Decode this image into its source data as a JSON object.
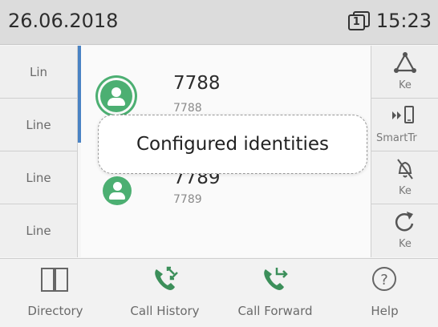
{
  "status": {
    "date": "26.06.2018",
    "line_number": "1",
    "time": "15:23"
  },
  "line_keys": [
    "Lin",
    "Line",
    "Line",
    "Line"
  ],
  "identities": [
    {
      "name": "7788",
      "number": "7788",
      "avatar_icon": "user-icon",
      "selected": true
    },
    {
      "name": "7789",
      "number": "7789",
      "avatar_icon": "user-icon",
      "selected": false
    }
  ],
  "tooltip": "Configured identities",
  "function_keys": [
    {
      "label": "Ke",
      "icon": "network-icon"
    },
    {
      "label": "SmartTr",
      "icon": "smart-transfer-icon"
    },
    {
      "label": "Ke",
      "icon": "bell-off-icon"
    },
    {
      "label": "Ke",
      "icon": "refresh-icon"
    }
  ],
  "softkeys": [
    {
      "label": "Directory",
      "icon": "book-icon"
    },
    {
      "label": "Call History",
      "icon": "call-history-icon"
    },
    {
      "label": "Call Forward",
      "icon": "call-forward-icon"
    },
    {
      "label": "Help",
      "icon": "help-icon"
    }
  ],
  "colors": {
    "accent_green": "#4caf72",
    "focus_blue": "#4a83c4",
    "status_bar": "#dcdcdc"
  }
}
